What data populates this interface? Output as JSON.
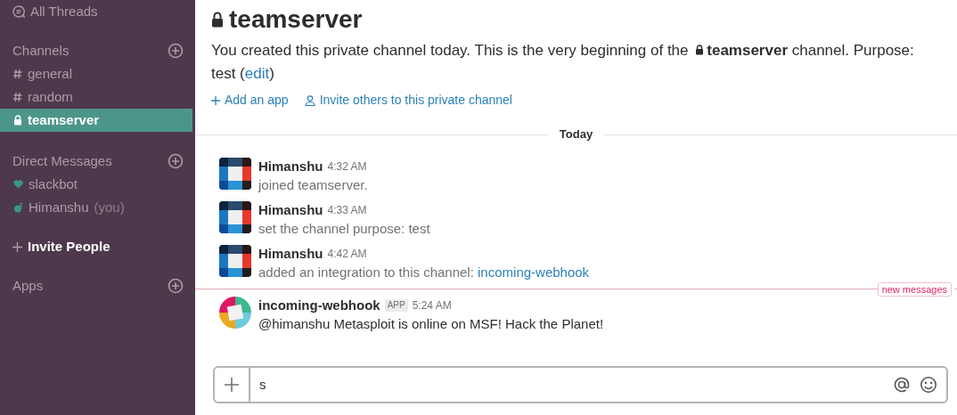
{
  "sidebar": {
    "all_threads": "All Threads",
    "sections": [
      {
        "title": "Channels",
        "items": [
          {
            "kind": "hash",
            "label": "general",
            "selected": false
          },
          {
            "kind": "hash",
            "label": "random",
            "selected": false
          },
          {
            "kind": "lock",
            "label": "teamserver",
            "selected": true
          }
        ]
      },
      {
        "title": "Direct Messages",
        "items": [
          {
            "kind": "heart",
            "label": "slackbot",
            "selected": false
          },
          {
            "kind": "away",
            "label": "Himanshu",
            "suffix": "(you)",
            "selected": false
          }
        ]
      }
    ],
    "invite": "Invite People",
    "apps": "Apps"
  },
  "channel": {
    "title": "teamserver",
    "intro_before": "You created this private channel today. This is the very beginning of the",
    "intro_channel": "teamserver",
    "intro_after": "channel. Purpose: test (",
    "edit": "edit",
    "intro_end": ")",
    "actions": [
      "Add an app",
      "Invite others to this private channel"
    ]
  },
  "day_divider": "Today",
  "messages": [
    {
      "kind": "user",
      "author": "Himanshu",
      "time": "4:32 AM",
      "text": "joined teamserver."
    },
    {
      "kind": "user",
      "author": "Himanshu",
      "time": "4:33 AM",
      "text": "set the channel purpose: test"
    },
    {
      "kind": "user",
      "author": "Himanshu",
      "time": "4:42 AM",
      "text": "added an integration to this channel:",
      "link": "incoming-webhook"
    },
    {
      "kind": "app",
      "author": "incoming-webhook",
      "badge": "APP",
      "time": "5:24 AM",
      "text": "@himanshu Metasploit is online on MSF! Hack the Planet!",
      "new_before": "new messages"
    }
  ],
  "composer": {
    "value": "s"
  }
}
